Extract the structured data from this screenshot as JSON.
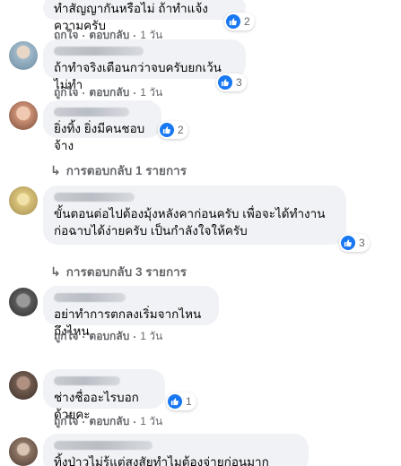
{
  "like_color": "#1877f2",
  "comments": [
    {
      "text": "ทำสัญญากันหรือไม่ ถ้าทำแจ้งความครับ",
      "reactions": "2",
      "actions": {
        "like": "ถูกใจ",
        "reply": "ตอบกลับ",
        "time": "1 วัน"
      }
    },
    {
      "text": "ถ้าทำจริงเตือนกว่าจบครับยกเว้นไม่ทำ",
      "reactions": "3",
      "actions": {
        "like": "ถูกใจ",
        "reply": "ตอบกลับ",
        "time": "1 วัน"
      }
    },
    {
      "text": "ยิ่งทิ้ง ยิ่งมีคนชอบจ้าง",
      "reactions": "2",
      "replies": "การตอบกลับ 1 รายการ"
    },
    {
      "text": "ขั้นตอนต่อไปต้องมุ้งหลังคาก่อนครับ เพื่อจะได้ทำงานก่อฉาบได้ง่ายครับ เป็นกำลังใจให้ครับ",
      "reactions": "3",
      "replies": "การตอบกลับ 3 รายการ"
    },
    {
      "text": "อย่าทำการตกลงเริ่มจากไหนถึงไหน",
      "actions": {
        "like": "ถูกใจ",
        "reply": "ตอบกลับ",
        "time": "1 วัน"
      }
    },
    {
      "text": "ช่างชื่ออะไรบอกด้วยคะ",
      "reactions": "1",
      "actions": {
        "like": "ถูกใจ",
        "reply": "ตอบกลับ",
        "time": "1 วัน"
      }
    },
    {
      "text": "ทิ้งป่าวไม่รู้แต่สงสัยทำไมต้องจ่ายก่อนมากขนาดนั้น"
    }
  ]
}
